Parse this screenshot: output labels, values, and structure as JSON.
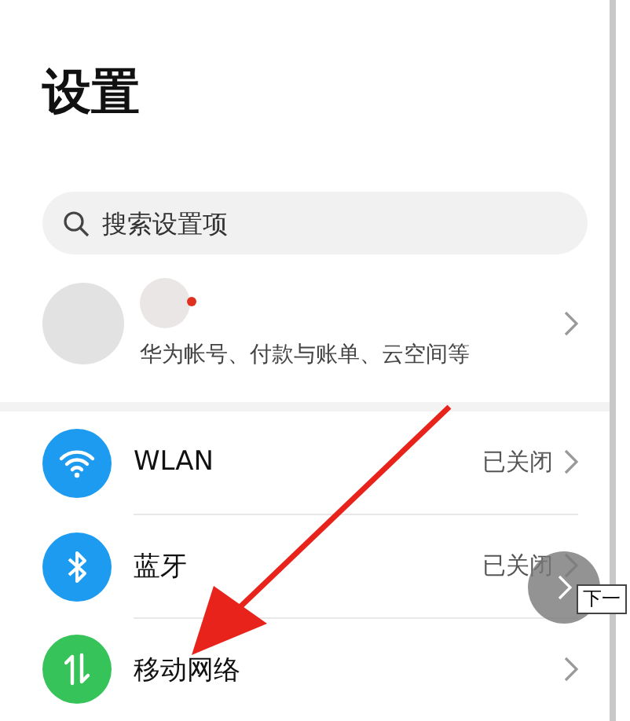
{
  "title": "设置",
  "search": {
    "placeholder": "搜索设置项"
  },
  "account": {
    "subtitle": "华为帐号、付款与账单、云空间等",
    "badge": true
  },
  "items": [
    {
      "kind": "wifi",
      "label": "WLAN",
      "value": "已关闭",
      "color": "#1d9bf0"
    },
    {
      "kind": "bluetooth",
      "label": "蓝牙",
      "value": "已关闭",
      "color": "#1d9bf0"
    },
    {
      "kind": "mobile",
      "label": "移动网络",
      "color": "#36c45a"
    }
  ],
  "tooltip": "下一"
}
